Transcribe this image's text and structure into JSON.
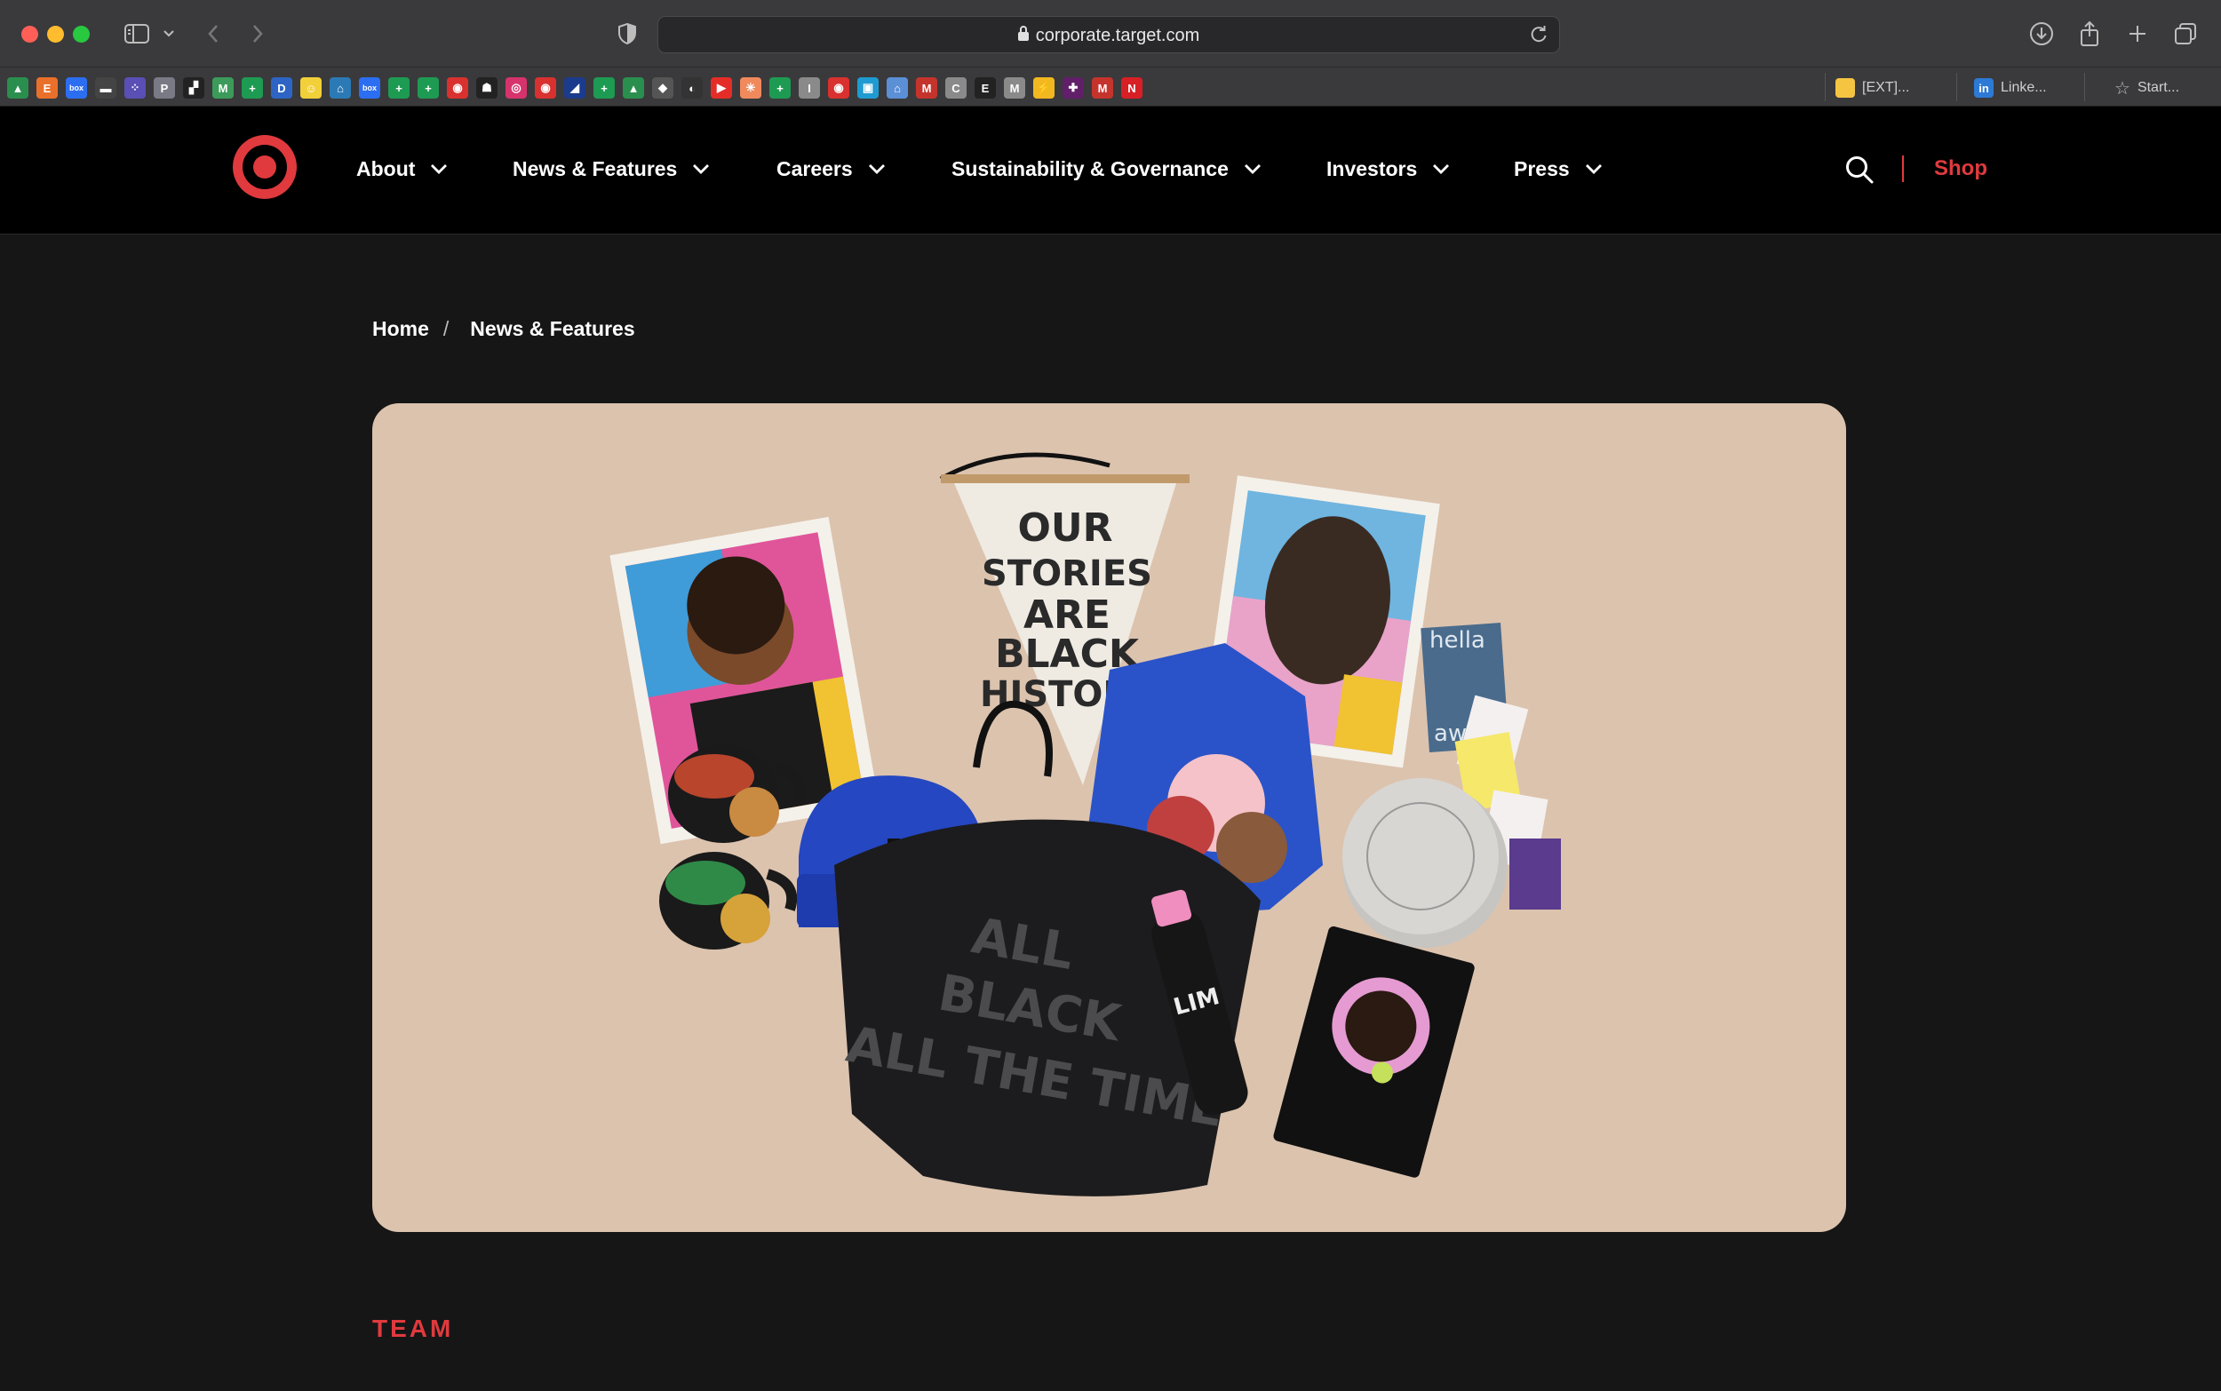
{
  "browser": {
    "url": "corporate.target.com",
    "bookmarks_text": [
      {
        "label": "[EXT]...",
        "color": "#f5c542"
      },
      {
        "label": "Linke...",
        "color": "#2d7ad6"
      },
      {
        "label": "Start...",
        "color": "#8a8a8a"
      }
    ],
    "bookmark_icons": [
      {
        "name": "google-drive-icon",
        "color": "#2a8f4e",
        "glyph": "▲"
      },
      {
        "name": "etsy-icon",
        "color": "#e9702a",
        "glyph": "E"
      },
      {
        "name": "box-icon",
        "color": "#2c6ef2",
        "glyph": "box"
      },
      {
        "name": "bookmark-icon",
        "color": "#444",
        "glyph": "▬"
      },
      {
        "name": "dots-icon",
        "color": "#5a4fb5",
        "glyph": "⁘"
      },
      {
        "name": "p-icon",
        "color": "#7a7a86",
        "glyph": "P"
      },
      {
        "name": "grid-icon",
        "color": "#222",
        "glyph": "▞"
      },
      {
        "name": "m-icon",
        "color": "#3c9b5a",
        "glyph": "M"
      },
      {
        "name": "sheets-icon",
        "color": "#1e9b52",
        "glyph": "+"
      },
      {
        "name": "dvp-icon",
        "color": "#2e65c4",
        "glyph": "D"
      },
      {
        "name": "smile-icon",
        "color": "#f2d03a",
        "glyph": "☺"
      },
      {
        "name": "shg-icon",
        "color": "#2b7ab5",
        "glyph": "⌂"
      },
      {
        "name": "box-icon",
        "color": "#2c6ef2",
        "glyph": "box"
      },
      {
        "name": "sheets-icon",
        "color": "#1e9b52",
        "glyph": "+"
      },
      {
        "name": "sheets-icon",
        "color": "#1e9b52",
        "glyph": "+"
      },
      {
        "name": "target-icon",
        "color": "#d8312f",
        "glyph": "◉"
      },
      {
        "name": "badge-icon",
        "color": "#222",
        "glyph": "☗"
      },
      {
        "name": "instagram-icon",
        "color": "#d6336c",
        "glyph": "◎"
      },
      {
        "name": "target-icon",
        "color": "#d8312f",
        "glyph": "◉"
      },
      {
        "name": "slash-icon",
        "color": "#1b3b8c",
        "glyph": "◢"
      },
      {
        "name": "sheets-icon",
        "color": "#1e9b52",
        "glyph": "+"
      },
      {
        "name": "google-drive-icon",
        "color": "#2a8f4e",
        "glyph": "▲"
      },
      {
        "name": "cube-icon",
        "color": "#555",
        "glyph": "◆"
      },
      {
        "name": "moon-icon",
        "color": "#333",
        "glyph": "◐"
      },
      {
        "name": "youtube-icon",
        "color": "#e52d27",
        "glyph": "▶"
      },
      {
        "name": "hub-icon",
        "color": "#f08a5d",
        "glyph": "✳"
      },
      {
        "name": "sheets-icon",
        "color": "#1e9b52",
        "glyph": "+"
      },
      {
        "name": "i-icon",
        "color": "#8a8a8a",
        "glyph": "I"
      },
      {
        "name": "target-icon",
        "color": "#d8312f",
        "glyph": "◉"
      },
      {
        "name": "square-icon",
        "color": "#1f9bd1",
        "glyph": "▣"
      },
      {
        "name": "home-icon",
        "color": "#5b8fd6",
        "glyph": "⌂"
      },
      {
        "name": "gmail-icon",
        "color": "#c5342c",
        "glyph": "M"
      },
      {
        "name": "c-icon",
        "color": "#8a8a8a",
        "glyph": "C"
      },
      {
        "name": "e-icon",
        "color": "#222",
        "glyph": "E"
      },
      {
        "name": "m-icon",
        "color": "#8a8a8a",
        "glyph": "M"
      },
      {
        "name": "lightning-icon",
        "color": "#f2b81f",
        "glyph": "⚡"
      },
      {
        "name": "slack-icon",
        "color": "#611f69",
        "glyph": "✚"
      },
      {
        "name": "gmail-icon",
        "color": "#c5342c",
        "glyph": "M"
      },
      {
        "name": "netflix-icon",
        "color": "#d81f26",
        "glyph": "N"
      }
    ]
  },
  "nav": {
    "items": [
      {
        "label": "About"
      },
      {
        "label": "News & Features"
      },
      {
        "label": "Careers"
      },
      {
        "label": "Sustainability & Governance"
      },
      {
        "label": "Investors"
      },
      {
        "label": "Press"
      }
    ],
    "shop": "Shop"
  },
  "breadcrumb": {
    "home": "Home",
    "separator": "/",
    "current": "News & Features"
  },
  "hero": {
    "pennant_text": [
      "OUR",
      "STORIES",
      "ARE",
      "BLACK",
      "HISTORY"
    ],
    "tote_text": [
      "ALL",
      "BLACK",
      "ALL THE TIME"
    ],
    "card_text": [
      "hella",
      "awk-"
    ],
    "bottle_text": "LIM",
    "colors": {
      "background": "#dcc3ae",
      "tote": "#1c1c1e",
      "beanie": "#2547c2",
      "shirt": "#2a53c9"
    }
  },
  "section": {
    "label": "TEAM"
  },
  "colors": {
    "brand_red": "#e03a3e",
    "page_bg": "#161616",
    "header_bg": "#000000"
  }
}
